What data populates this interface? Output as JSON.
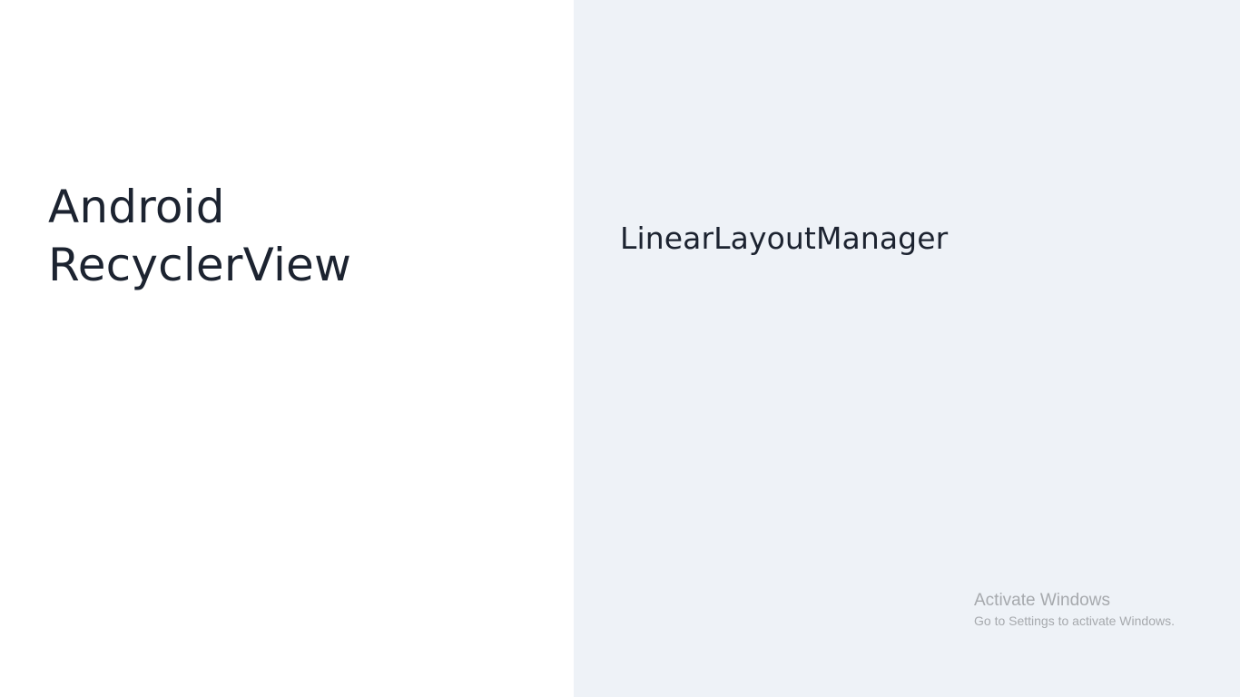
{
  "left": {
    "title_line1": "Android",
    "title_line2": "RecyclerView"
  },
  "right": {
    "heading": "LinearLayoutManager"
  },
  "watermark": {
    "title": "Activate Windows",
    "subtitle": "Go to Settings to activate Windows."
  },
  "colors": {
    "left_background": "#ffffff",
    "right_background": "#eef2f7",
    "text": "#1c2330",
    "watermark_text": "#a6a9ad"
  }
}
